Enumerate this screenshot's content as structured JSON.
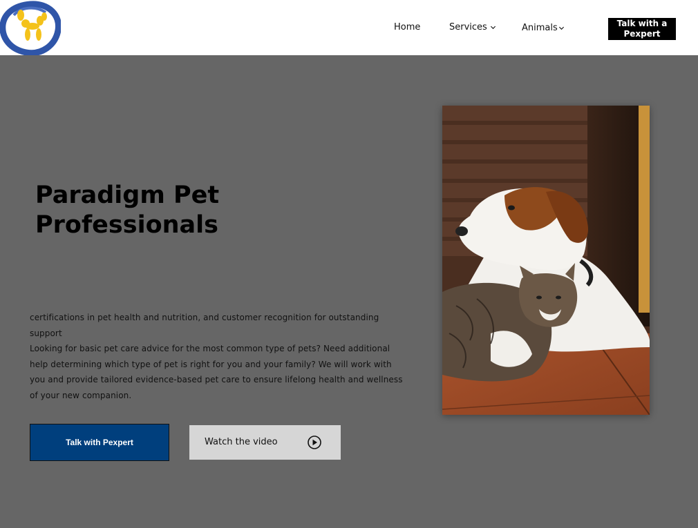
{
  "header": {
    "logo": {
      "icon": "balloon-dog-logo",
      "colors": {
        "ring": "#2f55a8",
        "dog": "#f4c21a"
      }
    },
    "nav": [
      {
        "label": "Home",
        "has_dropdown": false
      },
      {
        "label": "Services",
        "has_dropdown": true
      },
      {
        "label": "Animals",
        "has_dropdown": true
      }
    ],
    "cta": {
      "line1": "Talk with a",
      "line2": "Pexpert"
    }
  },
  "hero": {
    "title_line1": "Paradigm Pet",
    "title_line2": "Professionals",
    "paragraph1": "certifications in pet health and nutrition, and customer recognition for outstanding support",
    "paragraph2": "Looking for basic pet care advice for the most common type of pets? Need additional help determining which type of pet is right for you and your family? We will work with you and provide tailored evidence-based pet care to ensure lifelong health and wellness of your new companion.",
    "primary_button": "Talk with Pexpert",
    "video_button": "Watch the video",
    "video_icon": "play-circle-icon"
  },
  "colors": {
    "page_background": "#666666",
    "header_background": "#ffffff",
    "primary_button": "#003f7d",
    "video_button": "#d6d6d6",
    "cta_background": "#000000"
  }
}
